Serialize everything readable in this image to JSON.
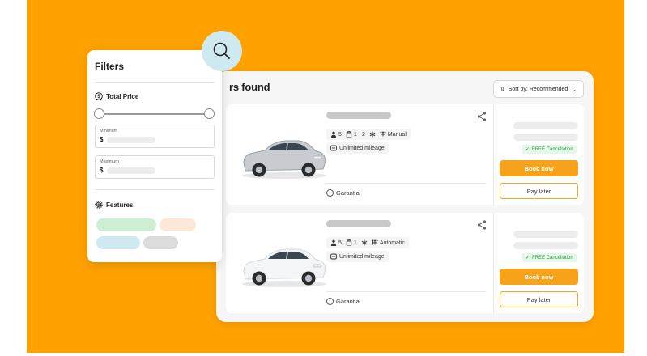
{
  "colors": {
    "background": "#FFA200",
    "accent": "#F7A21B",
    "free_cancellation": "#2f9a47"
  },
  "results": {
    "title": "rs found",
    "sort_label": "Sort by: Recommended",
    "cars": [
      {
        "seats": "5",
        "bags": "1 - 2",
        "transmission": "Manual",
        "mileage": "Unlimited mileage",
        "cancellation": "FREE Cancellation",
        "book_label": "Book now",
        "pay_later_label": "Pay later",
        "garantia": "Garantia",
        "car_color": "silver"
      },
      {
        "seats": "5",
        "bags": "1",
        "transmission": "Automatic",
        "mileage": "Unlimited mileage",
        "cancellation": "FREE Cancellation",
        "book_label": "Book now",
        "pay_later_label": "Pay later",
        "garantia": "Garantia",
        "car_color": "white"
      }
    ]
  },
  "filters": {
    "title": "Filters",
    "total_price_label": "Total Price",
    "minimum_label": "Minimum",
    "maximum_label": "Maximum",
    "currency": "$",
    "features_label": "Features"
  },
  "icons": {
    "search": "search-icon",
    "dollar": "dollar-icon",
    "gear": "gear-icon",
    "share": "share-icon",
    "person": "person-icon",
    "luggage": "luggage-icon",
    "snowflake": "ac-icon",
    "gearshift": "gearshift-icon",
    "mileage": "speedometer-icon",
    "info": "info-icon",
    "check": "check-icon",
    "sort": "sort-icon",
    "chevron": "chevron-down-icon"
  }
}
